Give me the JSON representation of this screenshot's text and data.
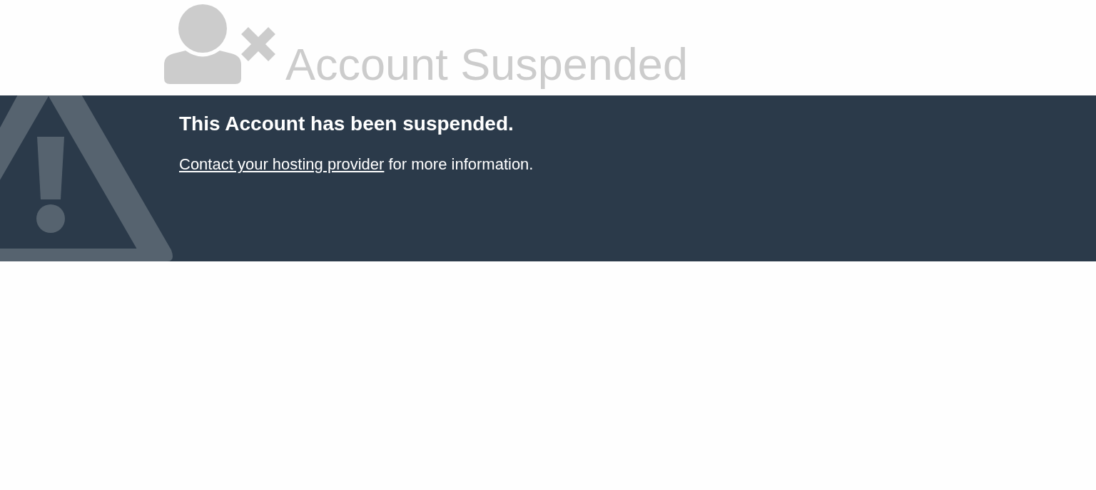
{
  "header": {
    "title": "Account Suspended"
  },
  "notice": {
    "heading": "This Account has been suspended.",
    "message": {
      "link": "Contact your hosting provider",
      "text": "for more information."
    }
  }
}
